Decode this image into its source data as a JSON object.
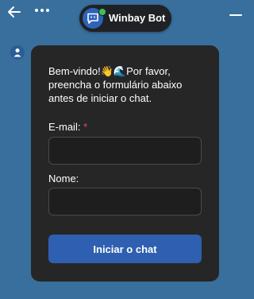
{
  "header": {
    "back_icon": "arrow-left-icon",
    "menu_icon": "more-dots-icon",
    "minimize_icon": "minimize-icon",
    "bot": {
      "name": "Winbay Bot",
      "avatar_icon": "chat-bot-icon",
      "status_color": "#3fbf5a"
    }
  },
  "chat": {
    "user_icon": "user-icon",
    "welcome_text": "Bem-vindo!👋🌊Por favor, preencha o formulário abaixo antes de iniciar o chat.",
    "form": {
      "email_label": "E-mail:",
      "email_required_mark": "*",
      "email_value": "",
      "name_label": "Nome:",
      "name_value": "",
      "submit_label": "Iniciar o chat"
    }
  },
  "colors": {
    "background": "#386f9c",
    "card": "#262626",
    "accent": "#2f5fb0",
    "required": "#e0505a"
  }
}
